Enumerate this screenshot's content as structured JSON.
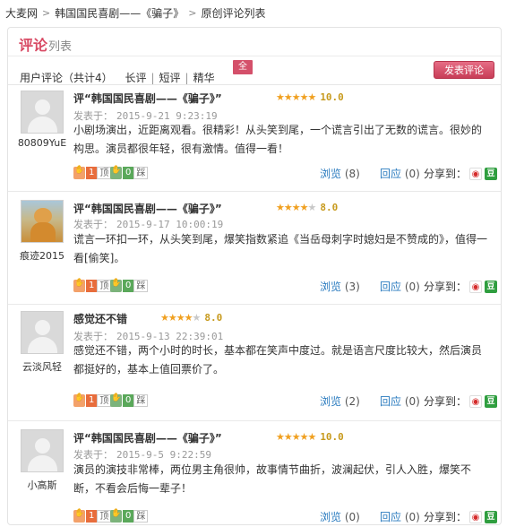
{
  "breadcrumb": [
    "大麦网",
    "韩国国民喜剧——《骗子》",
    "原创评论列表"
  ],
  "panel": {
    "title": "评论",
    "title_sub": "列表"
  },
  "filters": {
    "count_label": "用户评论（共计4）",
    "items": [
      "长评",
      "短评",
      "精华"
    ],
    "all_badge": "全"
  },
  "publish_button": "发表评论",
  "labels": {
    "posted_prefix": "发表于：",
    "views": "浏览",
    "replies": "回应",
    "share": "分享到：",
    "up": "顶",
    "down": "踩"
  },
  "reviews": [
    {
      "user": "80809YuE",
      "avatar": "default-avatar",
      "title": "评“韩国国民喜剧——《骗子》”",
      "stars": 5,
      "score": "10.0",
      "date": "2015-9-21 9:23:19",
      "body": "小剧场演出，近距离观看。很精彩！从头笑到尾，一个谎言引出了无数的谎言。很妙的构思。演员都很年轻，很有激情。值得一看！",
      "up": "1",
      "down": "0",
      "views": "(8)",
      "replies": "(0)"
    },
    {
      "user": "痕迹2015",
      "avatar": "photo-avatar",
      "title": "评“韩国国民喜剧——《骗子》”",
      "stars": 4,
      "score": "8.0",
      "date": "2015-9-17 10:00:19",
      "body": "谎言一环扣一环，从头笑到尾，爆笑指数紧追《当岳母刺字时媳妇是不赞成的》，值得一看[偷笑]。",
      "up": "1",
      "down": "0",
      "views": "(3)",
      "replies": "(0)"
    },
    {
      "user": "云淡风轻",
      "avatar": "default-avatar",
      "title": "感觉还不错",
      "stars": 4,
      "score": "8.0",
      "date": "2015-9-13 22:39:01",
      "body": "感觉还不错，两个小时的时长，基本都在笑声中度过。就是语言尺度比较大，然后演员都挺好的，基本上值回票价了。",
      "up": "1",
      "down": "0",
      "views": "(2)",
      "replies": "(0)"
    },
    {
      "user": "小高斯",
      "avatar": "default-avatar",
      "title": "评“韩国国民喜剧——《骗子》”",
      "stars": 5,
      "score": "10.0",
      "date": "2015-9-5 9:22:59",
      "body": "演员的演技非常棒，两位男主角很帅，故事情节曲折，波澜起伏，引人入胜，爆笑不断，不看会后悔一辈子！",
      "up": "1",
      "down": "0",
      "views": "(0)",
      "replies": "(0)"
    }
  ],
  "colors": {
    "accent": "#d84a64",
    "star": "#f0a020",
    "link": "#2a7bbf"
  }
}
